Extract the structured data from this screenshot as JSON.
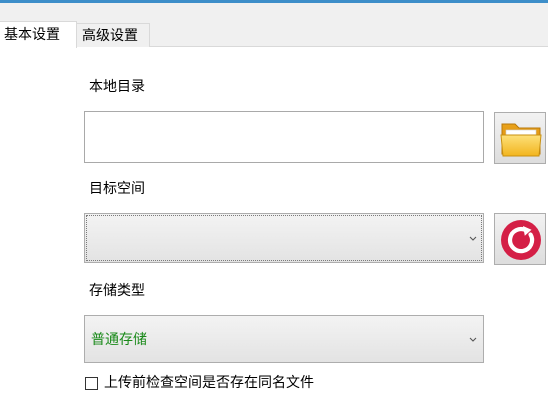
{
  "tabs": [
    {
      "label": "基本设置",
      "active": true
    },
    {
      "label": "高级设置",
      "active": false
    }
  ],
  "form": {
    "local_dir": {
      "label": "本地目录",
      "value": "",
      "browse_icon": "folder-icon"
    },
    "target_space": {
      "label": "目标空间",
      "selected": "",
      "refresh_icon": "refresh-icon"
    },
    "storage_type": {
      "label": "存储类型",
      "selected": "普通存储"
    },
    "check_duplicates": {
      "label": "上传前检查空间是否存在同名文件",
      "checked": false
    }
  },
  "colors": {
    "accent_top": "#3d8ec9",
    "storage_value": "#1a8a1a",
    "refresh_icon": "#d41f46",
    "folder_icon": "#f2b51e"
  }
}
